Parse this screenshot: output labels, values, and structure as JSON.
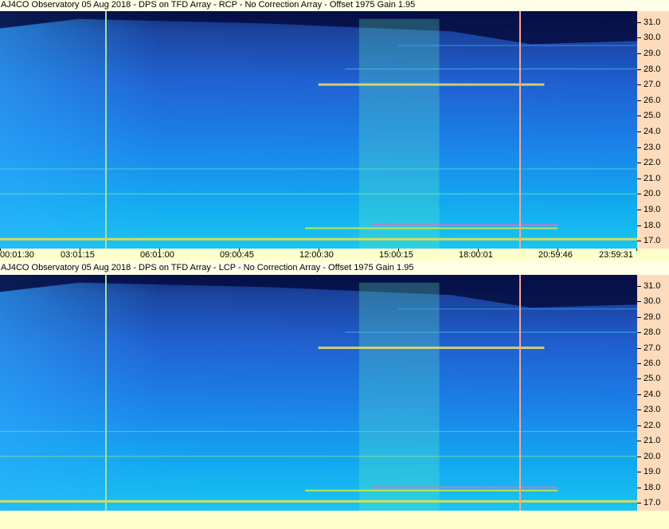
{
  "colors": {
    "marker_left": "#a8e0a0",
    "marker_right": "#f0a898",
    "axis_bg": "#fcdcbc",
    "time_bg": "#ffffcc"
  },
  "time_labels": [
    "00:01:30",
    "03:01:15",
    "06:01:00",
    "09:00:45",
    "12:00:30",
    "15:00:15",
    "18:00:01",
    "20:59:46",
    "23:59:31"
  ],
  "chart_data": [
    {
      "type": "heatmap",
      "title": "AJ4CO Observatory 05 Aug 2018 - DPS on TFD Array  - RCP  -  No Correction Array  -  Offset 1975  Gain 1.95",
      "x": [
        "00:01:30",
        "03:01:15",
        "06:01:00",
        "09:00:45",
        "12:00:30",
        "15:00:15",
        "18:00:01",
        "20:59:46",
        "23:59:31"
      ],
      "ylim": [
        16.5,
        31.7
      ],
      "yticks": [
        "17.0",
        "18.0",
        "19.0",
        "20.0",
        "21.0",
        "22.0",
        "23.0",
        "24.0",
        "25.0",
        "26.0",
        "27.0",
        "28.0",
        "29.0",
        "30.0",
        "31.0"
      ],
      "markers": [
        "04:01",
        "19:35"
      ],
      "bands_mhz": [
        17.1,
        17.8,
        18.0,
        20.0,
        21.6,
        27.0,
        28.0,
        29.5
      ]
    },
    {
      "type": "heatmap",
      "title": "AJ4CO Observatory 05 Aug 2018 - DPS on TFD Array  - LCP  -  No Correction Array  -  Offset 1975  Gain 1.95",
      "x": [
        "00:01:30",
        "03:01:15",
        "06:01:00",
        "09:00:45",
        "12:00:30",
        "15:00:15",
        "18:00:01",
        "20:59:46",
        "23:59:31"
      ],
      "ylim": [
        16.5,
        31.7
      ],
      "yticks": [
        "17.0",
        "18.0",
        "19.0",
        "20.0",
        "21.0",
        "22.0",
        "23.0",
        "24.0",
        "25.0",
        "26.0",
        "27.0",
        "28.0",
        "29.0",
        "30.0",
        "31.0"
      ],
      "markers": [
        "04:01",
        "19:35"
      ],
      "bands_mhz": [
        17.1,
        17.8,
        18.0,
        20.0,
        21.6,
        27.0,
        28.0,
        29.5
      ]
    }
  ]
}
